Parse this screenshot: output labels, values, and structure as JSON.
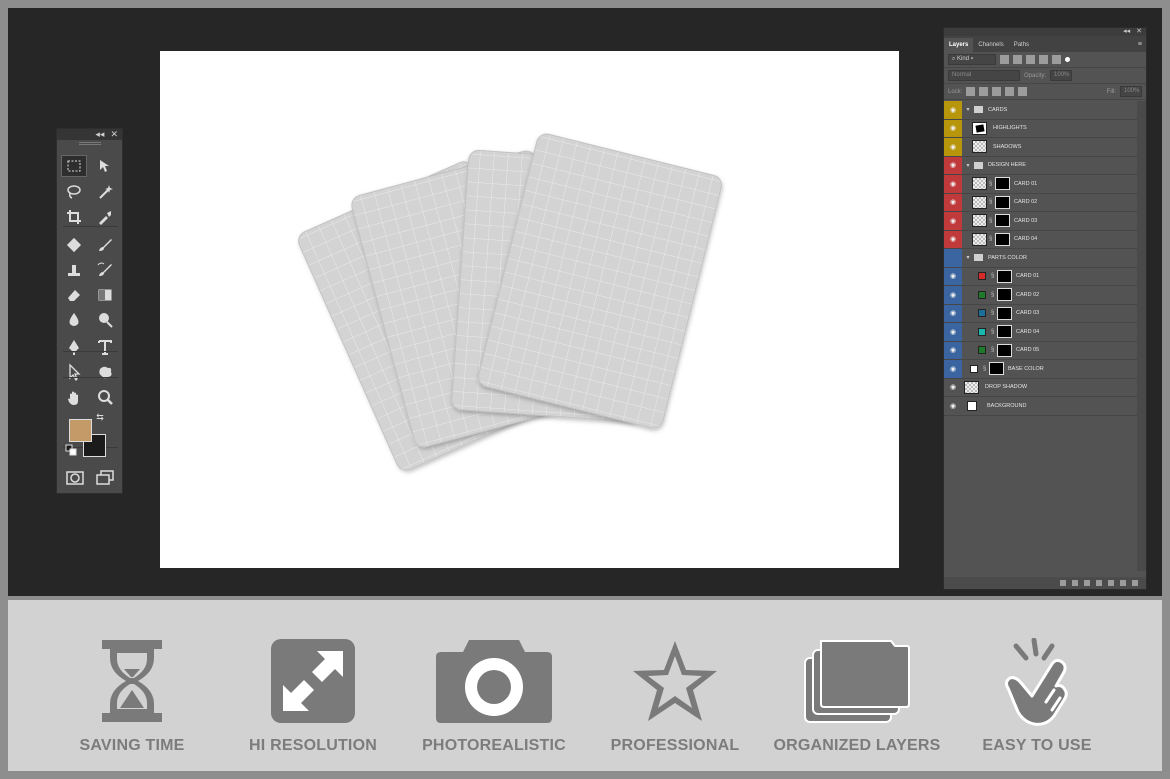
{
  "layers_panel": {
    "tabs": [
      {
        "label": "Layers",
        "active": true
      },
      {
        "label": "Channels",
        "active": false
      },
      {
        "label": "Paths",
        "active": false
      }
    ],
    "filter_kind": "Kind",
    "blend_mode": "Normal",
    "opacity_label": "Opacity:",
    "opacity_value": "100%",
    "lock_label": "Lock:",
    "fill_label": "Fill:",
    "fill_value": "100%",
    "layers": [
      {
        "name": "CARDS",
        "type": "group",
        "color": "#b8960c",
        "indent": 0
      },
      {
        "name": "HIGHLIGHTS",
        "type": "layer",
        "color": "#b8960c",
        "indent": 1
      },
      {
        "name": "SHADOWS",
        "type": "layer",
        "color": "#b8960c",
        "indent": 1
      },
      {
        "name": "DESIGN HERE",
        "type": "group",
        "color": "#c0393b",
        "indent": 0
      },
      {
        "name": "CARD 01",
        "type": "smart",
        "color": "#c0393b",
        "indent": 1
      },
      {
        "name": "CARD 02",
        "type": "smart",
        "color": "#c0393b",
        "indent": 1
      },
      {
        "name": "CARD 03",
        "type": "smart",
        "color": "#c0393b",
        "indent": 1
      },
      {
        "name": "CARD 04",
        "type": "smart",
        "color": "#c0393b",
        "indent": 1
      },
      {
        "name": "PARTS COLOR",
        "type": "group",
        "color": "#3a65a0",
        "indent": 0,
        "hidden": true
      },
      {
        "name": "CARD 01",
        "type": "fill",
        "color": "#3a65a0",
        "swatch": "#d62b2b",
        "indent": 1
      },
      {
        "name": "CARD 02",
        "type": "fill",
        "color": "#3a65a0",
        "swatch": "#1d7a2b",
        "indent": 1
      },
      {
        "name": "CARD 03",
        "type": "fill",
        "color": "#3a65a0",
        "swatch": "#1b6f9a",
        "indent": 1
      },
      {
        "name": "CARD 04",
        "type": "fill",
        "color": "#3a65a0",
        "swatch": "#18b8b0",
        "indent": 1
      },
      {
        "name": "CARD 05",
        "type": "fill",
        "color": "#3a65a0",
        "swatch": "#1d7a2b",
        "indent": 1
      },
      {
        "name": "BASE COLOR",
        "type": "fill",
        "color": "#3a65a0",
        "swatch": "#ffffff",
        "indent": 0
      },
      {
        "name": "DROP SHADOW",
        "type": "layer",
        "color": "",
        "indent": 0
      },
      {
        "name": "BACKGROUND",
        "type": "bg",
        "color": "",
        "indent": 0
      }
    ]
  },
  "tools_panel": {
    "foreground_color": "#c49a68",
    "background_color": "#1b1b1b",
    "tools": [
      "marquee-icon",
      "move-icon",
      "lasso-icon",
      "magic-wand-icon",
      "crop-icon",
      "eyedropper-icon",
      "healing-icon",
      "brush-icon",
      "stamp-icon",
      "history-brush-icon",
      "eraser-icon",
      "gradient-icon",
      "blur-icon",
      "dodge-icon",
      "pen-icon",
      "type-icon",
      "path-select-icon",
      "shape-icon",
      "hand-icon",
      "zoom-icon"
    ]
  },
  "features": [
    {
      "label": "SAVING TIME",
      "icon": "hourglass-icon"
    },
    {
      "label": "HI RESOLUTION",
      "icon": "expand-icon"
    },
    {
      "label": "PHOTOREALISTIC",
      "icon": "camera-icon"
    },
    {
      "label": "PROFESSIONAL",
      "icon": "star-icon"
    },
    {
      "label": "ORGANIZED LAYERS",
      "icon": "folders-icon"
    },
    {
      "label": "EASY TO USE",
      "icon": "tap-hand-icon"
    }
  ],
  "colors": {
    "workspace": "#262626",
    "canvas": "#ffffff",
    "card": "#d4d4d4",
    "feature_icon": "#7a7a7a"
  }
}
